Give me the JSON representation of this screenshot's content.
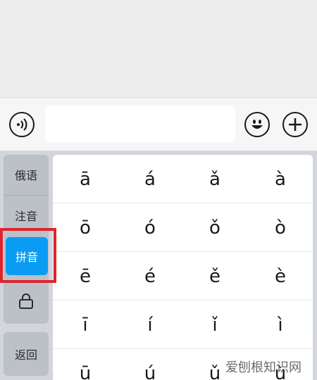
{
  "input_bar": {
    "voice_icon": "voice-icon",
    "emoji_icon": "emoji-icon",
    "plus_icon": "plus-icon",
    "text_value": ""
  },
  "side_panel": {
    "items": [
      "俄语",
      "注音",
      "拼音",
      "",
      "返回"
    ],
    "active": "拼音",
    "lock_icon": "lock-icon"
  },
  "grid": {
    "rows": [
      [
        "ā",
        "á",
        "ǎ",
        "à"
      ],
      [
        "ō",
        "ó",
        "ǒ",
        "ò"
      ],
      [
        "ē",
        "é",
        "ě",
        "è"
      ],
      [
        "ī",
        "í",
        "ǐ",
        "ì"
      ],
      [
        "ū",
        "ú",
        "ǔ",
        "ù"
      ]
    ]
  },
  "watermark": "爱刨根知识网",
  "colors": {
    "active_tab": "#0a9cf3",
    "highlight_box": "#e0232d"
  }
}
